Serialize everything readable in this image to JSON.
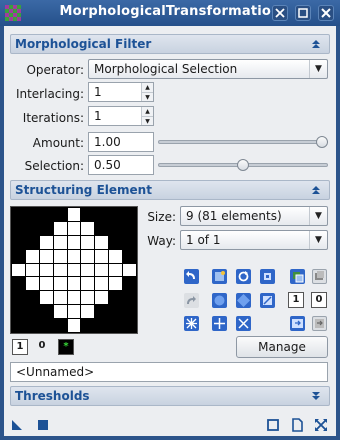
{
  "window": {
    "title": "MorphologicalTransformation",
    "title_buttons": [
      "✖",
      "▢",
      "✕"
    ]
  },
  "sections": {
    "filter": {
      "title": "Morphological Filter",
      "toggle": "▲"
    },
    "structuring": {
      "title": "Structuring Element",
      "toggle": "▲"
    },
    "thresholds": {
      "title": "Thresholds",
      "toggle": "▼"
    }
  },
  "filter": {
    "operator_label": "Operator:",
    "operator_value": "Morphological Selection",
    "interlacing_label": "Interlacing:",
    "interlacing_value": "1",
    "iterations_label": "Iterations:",
    "iterations_value": "1",
    "amount_label": "Amount:",
    "amount_value": "1.00",
    "amount_slider_level": 1.0,
    "selection_label": "Selection:",
    "selection_value": "0.50",
    "selection_slider_level": 0.5
  },
  "structuring": {
    "size_label": "Size:",
    "size_value": "9  (81 elements)",
    "way_label": "Way:",
    "way_value": "1 of 1",
    "manage_label": "Manage",
    "name_value": "<Unnamed>",
    "mask_buttons": [
      "1",
      "0",
      "*"
    ],
    "pattern": [
      [
        0,
        0,
        0,
        0,
        1,
        0,
        0,
        0,
        0
      ],
      [
        0,
        0,
        0,
        1,
        1,
        1,
        0,
        0,
        0
      ],
      [
        0,
        0,
        1,
        1,
        1,
        1,
        1,
        0,
        0
      ],
      [
        0,
        1,
        1,
        1,
        1,
        1,
        1,
        1,
        0
      ],
      [
        1,
        1,
        1,
        1,
        1,
        1,
        1,
        1,
        1
      ],
      [
        0,
        1,
        1,
        1,
        1,
        1,
        1,
        1,
        0
      ],
      [
        0,
        0,
        1,
        1,
        1,
        1,
        1,
        0,
        0
      ],
      [
        0,
        0,
        0,
        1,
        1,
        1,
        0,
        0,
        0
      ],
      [
        0,
        0,
        0,
        0,
        1,
        0,
        0,
        0,
        0
      ]
    ],
    "tool_icons": {
      "row1": [
        "rotate-left-icon",
        "rotate-right-icon",
        "rotate-cw-icon",
        "set-element-icon"
      ],
      "row2": [
        "redo-icon",
        "circle-icon",
        "diamond-icon",
        "invert-icon"
      ],
      "row3": [
        "cross-diagonal-icon",
        "cross-icon",
        "diagonal-icon"
      ],
      "side": [
        "copy-icon",
        "set-one-icon",
        "set-zero-icon",
        "clear-icon",
        "paste-icon"
      ]
    }
  },
  "colors": {
    "accent": "#1d5296",
    "title_bg": "#25508a",
    "panel_bg": "#eceef1",
    "icon_blue": "#2f66c8"
  },
  "bottom_icons": [
    "new-instance-icon",
    "apply-icon",
    "preview-icon",
    "document-icon",
    "reset-icon"
  ]
}
